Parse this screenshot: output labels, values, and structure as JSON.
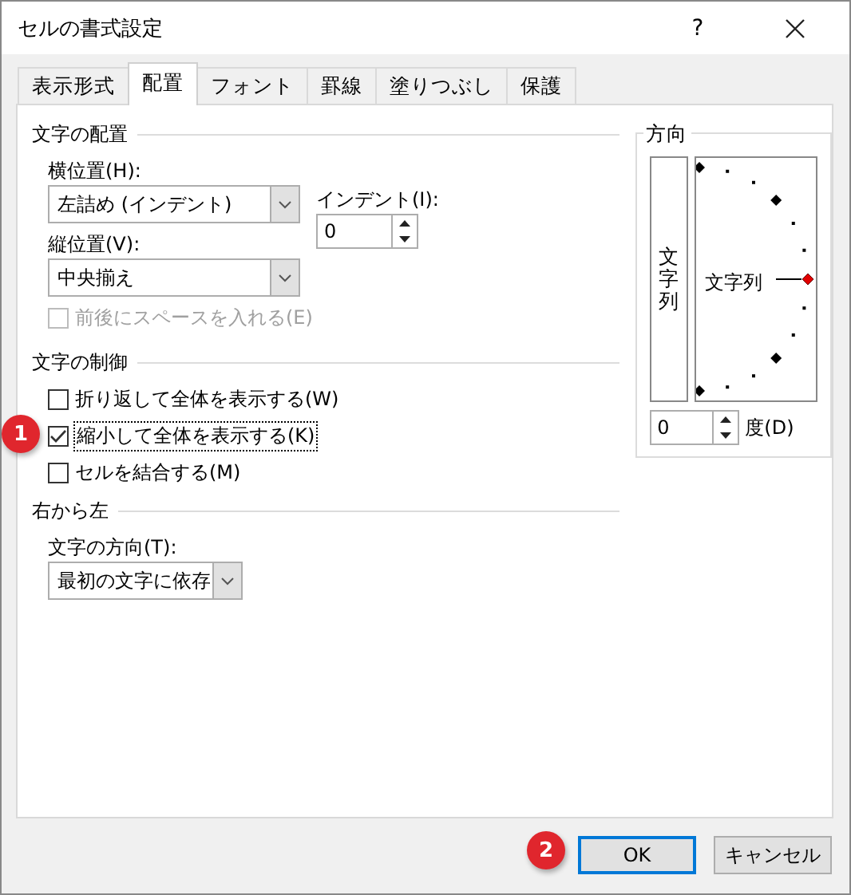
{
  "window": {
    "title": "セルの書式設定",
    "help": "?"
  },
  "tabs": [
    {
      "label": "表示形式",
      "selected": false
    },
    {
      "label": "配置",
      "selected": true
    },
    {
      "label": "フォント",
      "selected": false
    },
    {
      "label": "罫線",
      "selected": false
    },
    {
      "label": "塗りつぶし",
      "selected": false
    },
    {
      "label": "保護",
      "selected": false
    }
  ],
  "text_alignment": {
    "heading": "文字の配置",
    "horizontal": {
      "label": "横位置(H):",
      "value": "左詰め (インデント)"
    },
    "indent": {
      "label": "インデント(I):",
      "value": "0"
    },
    "vertical": {
      "label": "縦位置(V):",
      "value": "中央揃え"
    },
    "distributed": {
      "label": "前後にスペースを入れる(E)",
      "checked": false,
      "disabled": true
    }
  },
  "text_control": {
    "heading": "文字の制御",
    "options": [
      {
        "label": "折り返して全体を表示する(W)",
        "checked": false,
        "focused": false
      },
      {
        "label": "縮小して全体を表示する(K)",
        "checked": true,
        "focused": true
      },
      {
        "label": "セルを結合する(M)",
        "checked": false,
        "focused": false
      }
    ]
  },
  "right_to_left": {
    "heading": "右から左",
    "direction": {
      "label": "文字の方向(T):",
      "value": "最初の文字に依存"
    }
  },
  "orientation": {
    "heading": "方向",
    "vertical_text": "文字列",
    "horizontal_text": "文字列",
    "degrees": {
      "value": "0",
      "label": "度(D)"
    }
  },
  "buttons": [
    {
      "label": "OK",
      "default": true
    },
    {
      "label": "キャンセル",
      "default": false
    }
  ],
  "callouts": [
    {
      "number": "1"
    },
    {
      "number": "2"
    }
  ]
}
